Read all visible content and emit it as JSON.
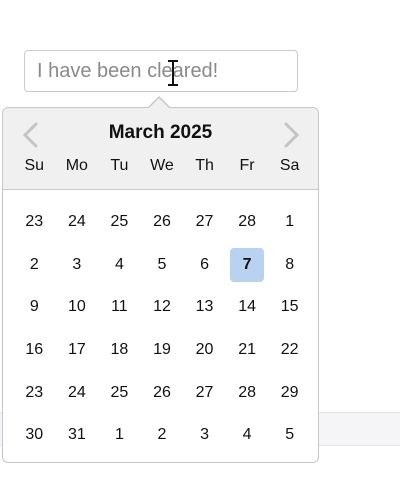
{
  "input": {
    "value": "",
    "placeholder": "I have been cleared!"
  },
  "calendar": {
    "month_title": "March 2025",
    "prev_icon": "chevron-left-icon",
    "next_icon": "chevron-right-icon",
    "weekdays": [
      "Su",
      "Mo",
      "Tu",
      "We",
      "Th",
      "Fr",
      "Sa"
    ],
    "weeks": [
      [
        "23",
        "24",
        "25",
        "26",
        "27",
        "28",
        "1"
      ],
      [
        "2",
        "3",
        "4",
        "5",
        "6",
        "7",
        "8"
      ],
      [
        "9",
        "10",
        "11",
        "12",
        "13",
        "14",
        "15"
      ],
      [
        "16",
        "17",
        "18",
        "19",
        "20",
        "21",
        "22"
      ],
      [
        "23",
        "24",
        "25",
        "26",
        "27",
        "28",
        "29"
      ],
      [
        "30",
        "31",
        "1",
        "2",
        "3",
        "4",
        "5"
      ]
    ],
    "selected": "7",
    "selected_color": "#b8d2f0",
    "header_color": "#f0f0f0"
  }
}
